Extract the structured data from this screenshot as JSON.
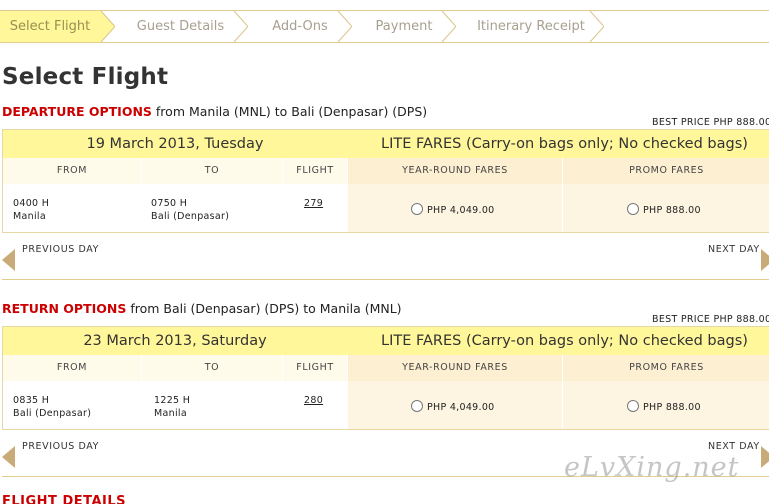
{
  "steps": [
    "Select Flight",
    "Guest Details",
    "Add-Ons",
    "Payment",
    "Itinerary Receipt"
  ],
  "page_title": "Select Flight",
  "departure": {
    "heading": "DEPARTURE OPTIONS",
    "route": "from Manila (MNL) to Bali (Denpasar) (DPS)",
    "best_price": "BEST PRICE PHP  888.00",
    "date": "19 March 2013, Tuesday",
    "fare_title": "LITE FARES (Carry-on bags only; No checked bags)",
    "columns": {
      "from": "FROM",
      "to": "TO",
      "flight": "FLIGHT",
      "year_round": "YEAR-ROUND FARES",
      "promo": "PROMO FARES"
    },
    "row": {
      "from_time": "0400 H",
      "from_city": "Manila",
      "to_time": "0750 H",
      "to_city": "Bali (Denpasar)",
      "flight_no": "279",
      "year_round_price": "PHP  4,049.00",
      "promo_price": "PHP  888.00"
    },
    "prev_label": "PREVIOUS DAY",
    "next_label": "NEXT DAY"
  },
  "return": {
    "heading": "RETURN OPTIONS",
    "route": "from Bali (Denpasar) (DPS) to Manila (MNL)",
    "best_price": "BEST PRICE PHP  888.00",
    "date": "23 March 2013, Saturday",
    "fare_title": "LITE FARES (Carry-on bags only; No checked bags)",
    "columns": {
      "from": "FROM",
      "to": "TO",
      "flight": "FLIGHT",
      "year_round": "YEAR-ROUND FARES",
      "promo": "PROMO FARES"
    },
    "row": {
      "from_time": "0835 H",
      "from_city": "Bali (Denpasar)",
      "to_time": "1225 H",
      "to_city": "Manila",
      "flight_no": "280",
      "year_round_price": "PHP  4,049.00",
      "promo_price": "PHP  888.00"
    },
    "prev_label": "PREVIOUS DAY",
    "next_label": "NEXT DAY"
  },
  "flight_details_heading": "FLIGHT DETAILS",
  "watermark": "eLvXing.net",
  "colors": {
    "accent_yellow": "#fff79a",
    "heading_red": "#cc0000",
    "arrow": "#c9aa79",
    "border": "#e3cd8d"
  }
}
